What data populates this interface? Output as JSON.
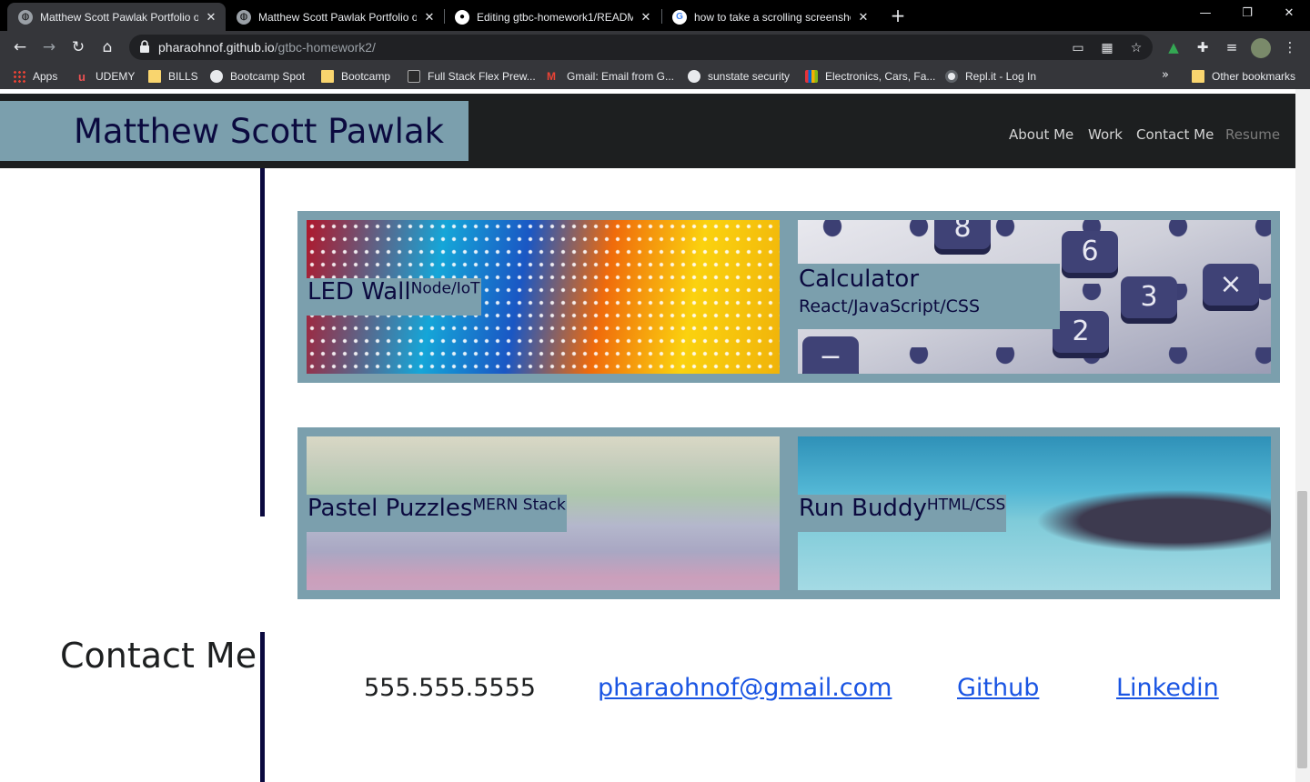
{
  "browser": {
    "tabs": [
      {
        "title": "Matthew Scott Pawlak Portfolio o",
        "active": true
      },
      {
        "title": "Matthew Scott Pawlak Portfolio o",
        "active": false
      },
      {
        "title": "Editing gtbc-homework1/READM",
        "active": false
      },
      {
        "title": "how to take a scrolling screensho",
        "active": false
      }
    ],
    "new_tab": "+",
    "url_host": "pharaohnof.github.io",
    "url_path": "/gtbc-homework2/",
    "bookmarks": [
      {
        "label": "Apps",
        "icon": "apps-grid-icon"
      },
      {
        "label": "UDEMY",
        "icon": "udemy-icon"
      },
      {
        "label": "BILLS",
        "icon": "folder-icon"
      },
      {
        "label": "Bootcamp Spot",
        "icon": "globe-icon"
      },
      {
        "label": "Bootcamp",
        "icon": "folder-icon"
      },
      {
        "label": "Full Stack Flex Prew...",
        "icon": "book-icon"
      },
      {
        "label": "Gmail: Email from G...",
        "icon": "gmail-icon"
      },
      {
        "label": "sunstate security",
        "icon": "globe-icon"
      },
      {
        "label": "Electronics, Cars, Fa...",
        "icon": "ebay-icon"
      },
      {
        "label": "Repl.it - Log In",
        "icon": "replit-icon"
      }
    ],
    "bookmarks_more": "»",
    "other_bookmarks": "Other bookmarks"
  },
  "site": {
    "name": "Matthew Scott Pawlak",
    "nav": [
      "About Me",
      "Work",
      "Contact Me",
      "Resume"
    ],
    "projects": [
      {
        "name": "LED Wall",
        "tech": "Node/IoT",
        "image": "led-wall-image"
      },
      {
        "name": "Calculator",
        "tech": "React/JavaScript/CSS",
        "image": "calculator-image"
      },
      {
        "name": "Pastel Puzzles",
        "tech": "MERN Stack",
        "image": "pastel-puzzles-image"
      },
      {
        "name": "Run Buddy",
        "tech": "HTML/CSS",
        "image": "run-buddy-image"
      }
    ],
    "calc_keys": [
      "8",
      "6",
      "3",
      "2",
      "×",
      "−"
    ],
    "contact": {
      "title": "Contact Me",
      "phone": "555.555.5555",
      "email": "pharaohnof@gmail.com",
      "github": "Github",
      "linkedin": "Linkedin"
    }
  },
  "colors": {
    "accent": "#7b9fad",
    "navy": "#0b0a3f",
    "header_bg": "#1d1f20",
    "link": "#1a55e3"
  }
}
